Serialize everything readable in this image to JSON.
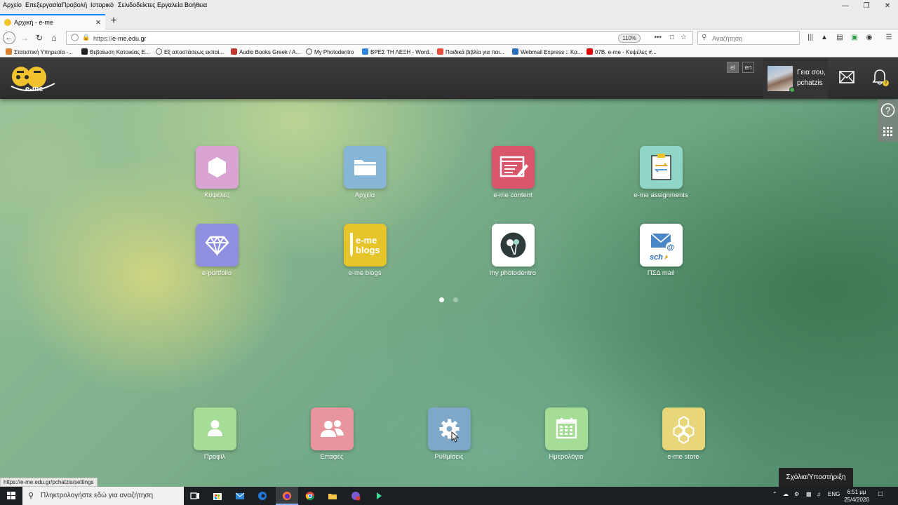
{
  "menubar": {
    "items": [
      "Αρχείο",
      "Επεξεργασία",
      "Προβολή",
      "Ιστορικό",
      "Σελιδοδείκτες",
      "Εργαλεία",
      "Βοήθεια"
    ]
  },
  "tab": {
    "title": "Αρχική - e-me"
  },
  "navbar": {
    "url_prefix": "https://",
    "url_host": "e-me.edu.gr",
    "zoom": "110%",
    "search_placeholder": "Αναζήτηση"
  },
  "bookmarks": [
    {
      "label": "Στατιστική Υπηρεσία -...",
      "color": "#d9822b"
    },
    {
      "label": "Βεβαίωση Κατοικίας Ε...",
      "color": "#222222"
    },
    {
      "label": "Εξ αποστάσεως εκπαί...",
      "color": "#555555"
    },
    {
      "label": "Audio Books Greek / A...",
      "color": "#c0392b"
    },
    {
      "label": "My Photodentro",
      "color": "#555555"
    },
    {
      "label": "ΒΡΕΣ ΤΗ ΛΕΞΗ - Word...",
      "color": "#2e86de"
    },
    {
      "label": "Παιδικά βιβλία για παι...",
      "color": "#e74c3c"
    },
    {
      "label": "Webmail Express :: Κα...",
      "color": "#2c6fbb"
    },
    {
      "label": "07Β. e-me - Κυψέλες #...",
      "color": "#e00000"
    }
  ],
  "header": {
    "lang_el": "el",
    "lang_en": "en",
    "greeting_line1": "Γεια σου,",
    "greeting_line2": "pchatzis",
    "notification_count": "3"
  },
  "apps_row1": [
    {
      "label": "Κυψέλες",
      "color": "#d9a3d3",
      "icon": "hexagon-icon"
    },
    {
      "label": "Αρχεία",
      "color": "#86b5d6",
      "icon": "folder-icon"
    },
    {
      "label": "e-me content",
      "color": "#d9566a",
      "icon": "content-editor-icon"
    },
    {
      "label": "e-me assignments",
      "color": "#8fd6c6",
      "icon": "clipboard-icon"
    }
  ],
  "apps_row2": [
    {
      "label": "e-portfolio",
      "color": "#8e8fe0",
      "icon": "diamond-icon"
    },
    {
      "label": "e-me blogs",
      "color": "#e6c52a",
      "icon": "blogs-icon",
      "tile_text_1": "e-me",
      "tile_text_2": "blogs"
    },
    {
      "label": "my photodentro",
      "color": "#ffffff",
      "icon": "photodentro-icon"
    },
    {
      "label": "ΠΣΔ mail",
      "color": "#ffffff",
      "icon": "sch-mail-icon",
      "tile_text": "sch"
    }
  ],
  "dock": [
    {
      "label": "Προφίλ",
      "color": "#a5dc96",
      "icon": "user-icon"
    },
    {
      "label": "Επαφές",
      "color": "#e8959d",
      "icon": "contacts-icon"
    },
    {
      "label": "Ρυθμίσεις",
      "color": "#7fa8c8",
      "icon": "gear-icon"
    },
    {
      "label": "Ημερολόγιο",
      "color": "#a5dc96",
      "icon": "calendar-icon"
    },
    {
      "label": "e-me store",
      "color": "#e8d77a",
      "icon": "honeycomb-icon"
    }
  ],
  "pager": {
    "active": 1,
    "total": 2
  },
  "support_label": "Σχόλια/Υποστήριξη",
  "status_link": "https://e-me.edu.gr/pchatzis/settings",
  "taskbar": {
    "search_placeholder": "Πληκτρολογήστε εδώ για αναζήτηση",
    "lang": "ENG",
    "time": "6:51 μμ",
    "date": "25/4/2020"
  },
  "colors": {
    "accent": "#0a84ff",
    "topbar": "#333333"
  }
}
